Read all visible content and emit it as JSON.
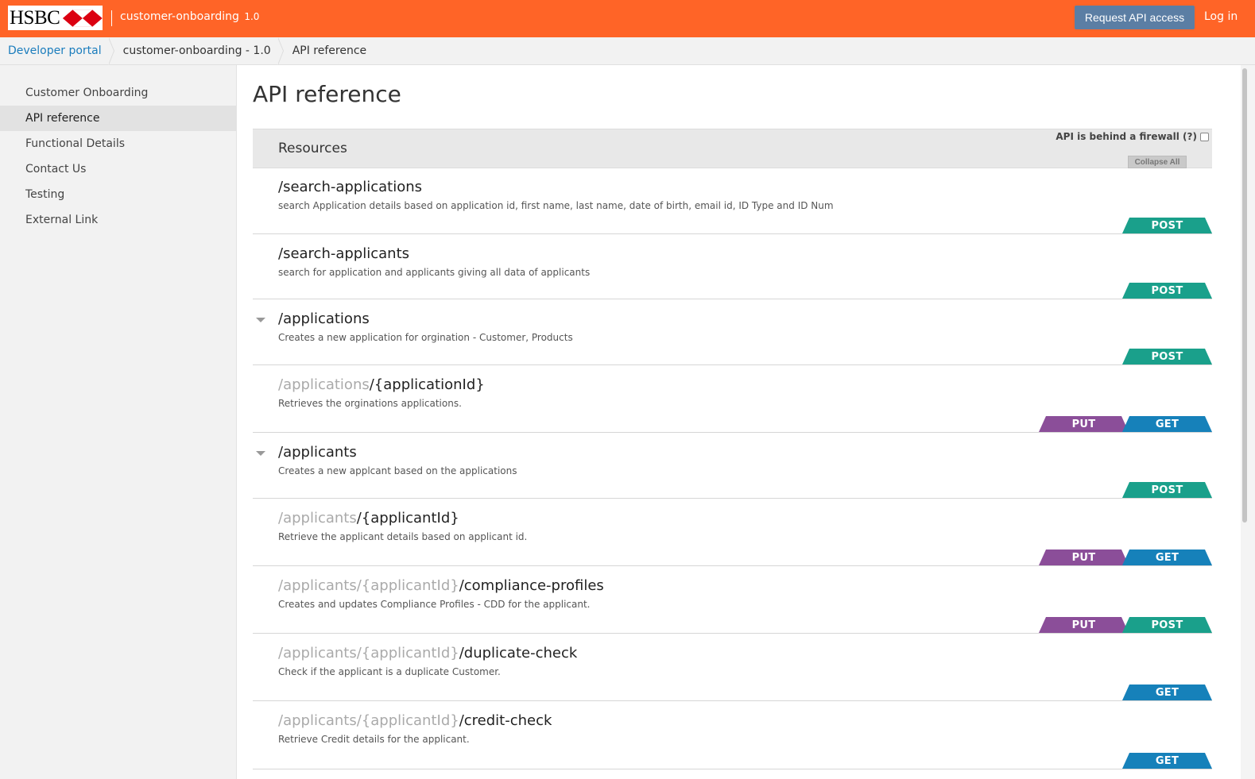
{
  "header": {
    "logo_text": "HSBC",
    "app_name": "customer-onboarding",
    "app_version": "1.0",
    "request_label": "Request API access",
    "login_label": "Log in",
    "brand_color": "#ff6427"
  },
  "breadcrumb": {
    "items": [
      "Developer portal",
      "customer-onboarding - 1.0",
      "API reference"
    ]
  },
  "sidebar": {
    "items": [
      {
        "label": "Customer Onboarding",
        "active": false
      },
      {
        "label": "API reference",
        "active": true
      },
      {
        "label": "Functional Details",
        "active": false
      },
      {
        "label": "Contact Us",
        "active": false
      },
      {
        "label": "Testing",
        "active": false
      },
      {
        "label": "External Link",
        "active": false
      }
    ]
  },
  "main": {
    "title": "API reference",
    "resources_title": "Resources",
    "firewall_label": "API is behind a firewall (?)",
    "firewall_checked": false,
    "collapse_label": "Collapse All",
    "method_colors": {
      "POST": "#1aa08b",
      "GET": "#1681ba",
      "PUT": "#8b4e99"
    },
    "resources": [
      {
        "path_dim": "",
        "path": "/search-applications",
        "desc": "search Application details based on application id, first name, last name, date of birth, email id, ID Type and ID Num",
        "methods": [
          "POST"
        ],
        "caret": false
      },
      {
        "path_dim": "",
        "path": "/search-applicants",
        "desc": "search for application and applicants giving all data of applicants",
        "methods": [
          "POST"
        ],
        "caret": false
      },
      {
        "path_dim": "",
        "path": "/applications",
        "desc": "Creates a new application for orgination - Customer, Products",
        "methods": [
          "POST"
        ],
        "caret": true
      },
      {
        "path_dim": "/applications",
        "path": "/{applicationId}",
        "desc": "Retrieves the orginations applications.",
        "methods": [
          "PUT",
          "GET"
        ],
        "caret": false
      },
      {
        "path_dim": "",
        "path": "/applicants",
        "desc": "Creates a new applcant based on the applications",
        "methods": [
          "POST"
        ],
        "caret": true
      },
      {
        "path_dim": "/applicants",
        "path": "/{applicantId}",
        "desc": "Retrieve the applicant details based on applicant id.",
        "methods": [
          "PUT",
          "GET"
        ],
        "caret": false
      },
      {
        "path_dim": "/applicants/{applicantId}",
        "path": "/compliance-profiles",
        "desc": "Creates and updates Compliance Profiles - CDD for the applicant.",
        "methods": [
          "PUT",
          "POST"
        ],
        "caret": false
      },
      {
        "path_dim": "/applicants/{applicantId}",
        "path": "/duplicate-check",
        "desc": "Check if the applicant is a duplicate Customer.",
        "methods": [
          "GET"
        ],
        "caret": false
      },
      {
        "path_dim": "/applicants/{applicantId}",
        "path": "/credit-check",
        "desc": "Retrieve Credit details for the applicant.",
        "methods": [
          "GET"
        ],
        "caret": false
      }
    ]
  }
}
